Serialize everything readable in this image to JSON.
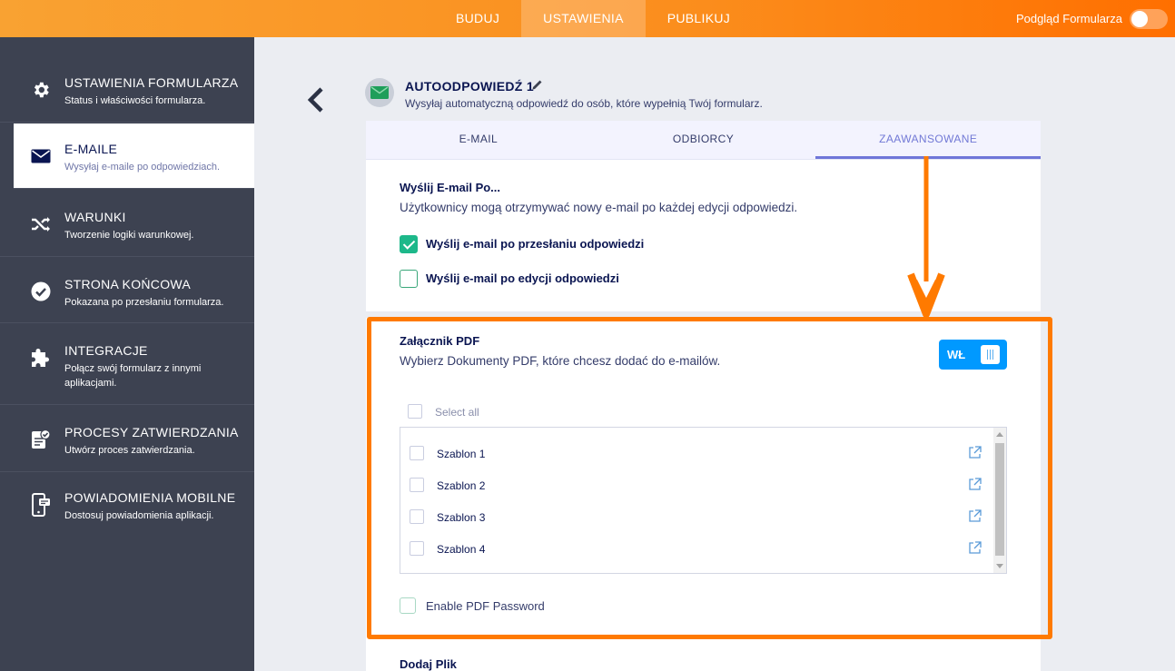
{
  "topbar": {
    "tabs": [
      "BUDUJ",
      "USTAWIENIA",
      "PUBLIKUJ"
    ],
    "active_tab": "USTAWIENIA",
    "preview_label": "Podgląd Formularza"
  },
  "sidebar": {
    "items": [
      {
        "title": "USTAWIENIA FORMULARZA",
        "subtitle": "Status i właściwości formularza.",
        "icon": "gear-icon"
      },
      {
        "title": "E-MAILE",
        "subtitle": "Wysyłaj e-maile po odpowiedziach.",
        "icon": "envelope-icon"
      },
      {
        "title": "WARUNKI",
        "subtitle": "Tworzenie logiki warunkowej.",
        "icon": "shuffle-icon"
      },
      {
        "title": "STRONA KOŃCOWA",
        "subtitle": "Pokazana po przesłaniu formularza.",
        "icon": "check-circle-icon"
      },
      {
        "title": "INTEGRACJE",
        "subtitle": "Połącz swój formularz z innymi aplikacjami.",
        "icon": "puzzle-icon"
      },
      {
        "title": "PROCESY ZATWIERDZANIA",
        "subtitle": "Utwórz proces zatwierdzania.",
        "icon": "approval-icon"
      },
      {
        "title": "POWIADOMIENIA MOBILNE",
        "subtitle": "Dostosuj powiadomienia aplikacji.",
        "icon": "mobile-icon"
      }
    ],
    "active_index": 1
  },
  "header": {
    "title": "AUTOODPOWIEDŹ 1",
    "subtitle": "Wysyłaj automatyczną odpowiedź do osób, które wypełnią Twój formularz."
  },
  "tabs": [
    "E-MAIL",
    "ODBIORCY",
    "ZAAWANSOWANE"
  ],
  "send_section": {
    "title": "Wyślij E-mail Po...",
    "description": "Użytkownicy mogą otrzymywać nowy e-mail po każdej edycji odpowiedzi.",
    "options": [
      {
        "label": "Wyślij e-mail po przesłaniu odpowiedzi",
        "checked": true
      },
      {
        "label": "Wyślij e-mail po edycji odpowiedzi",
        "checked": false
      }
    ]
  },
  "pdf_section": {
    "title": "Załącznik PDF",
    "description": "Wybierz Dokumenty PDF, które chcesz dodać do e-mailów.",
    "toggle_label": "WŁ",
    "select_all": "Select all",
    "templates": [
      "Szablon 1",
      "Szablon 2",
      "Szablon 3",
      "Szablon 4"
    ],
    "password_label": "Enable PDF Password"
  },
  "file_section": {
    "title": "Dodaj Plik"
  },
  "colors": {
    "accent_orange": "#ff7a00",
    "sidebar_bg": "#3d4251",
    "toggle_blue": "#0099ff",
    "tab_active": "#6f76d9"
  }
}
